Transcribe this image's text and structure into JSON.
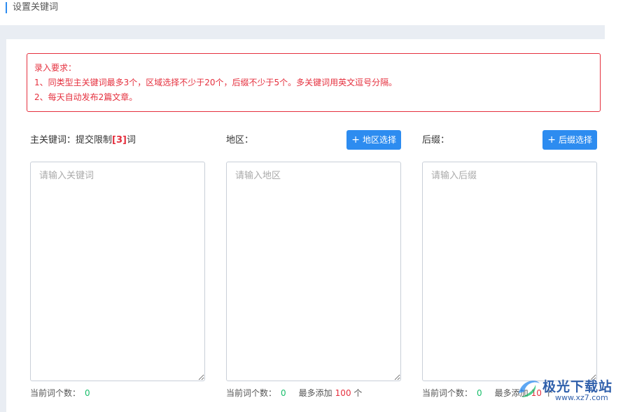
{
  "header": {
    "title": "设置关键词"
  },
  "notice": {
    "line1": "录入要求：",
    "line2": "1、同类型主关键词最多3个，区域选择不少于20个，后缀不少于5个。多关键词用英文逗号分隔。",
    "line3": "2、每天自动发布2篇文章。"
  },
  "columns": {
    "main": {
      "label": "主关键词：提交限制",
      "limit": "[3]",
      "suffix": "词",
      "placeholder": "请输入关键词",
      "count_label": "当前词个数：",
      "count": "0"
    },
    "region": {
      "label": "地区：",
      "button": "地区选择",
      "placeholder": "请输入地区",
      "count_label": "当前词个数：",
      "count": "0",
      "max_label": "最多添加",
      "max": "100",
      "unit": "个"
    },
    "suffix": {
      "label": "后缀：",
      "button": "后缀选择",
      "placeholder": "请输入后缀",
      "count_label": "当前词个数：",
      "count": "0",
      "max_label": "最多添加",
      "max": "10",
      "unit": "个"
    }
  },
  "watermark": {
    "name": "极光下载站",
    "url": "www.xz7.com"
  },
  "colors": {
    "accent": "#2d8cf0",
    "danger": "#e5303e",
    "success": "#19be6b"
  }
}
